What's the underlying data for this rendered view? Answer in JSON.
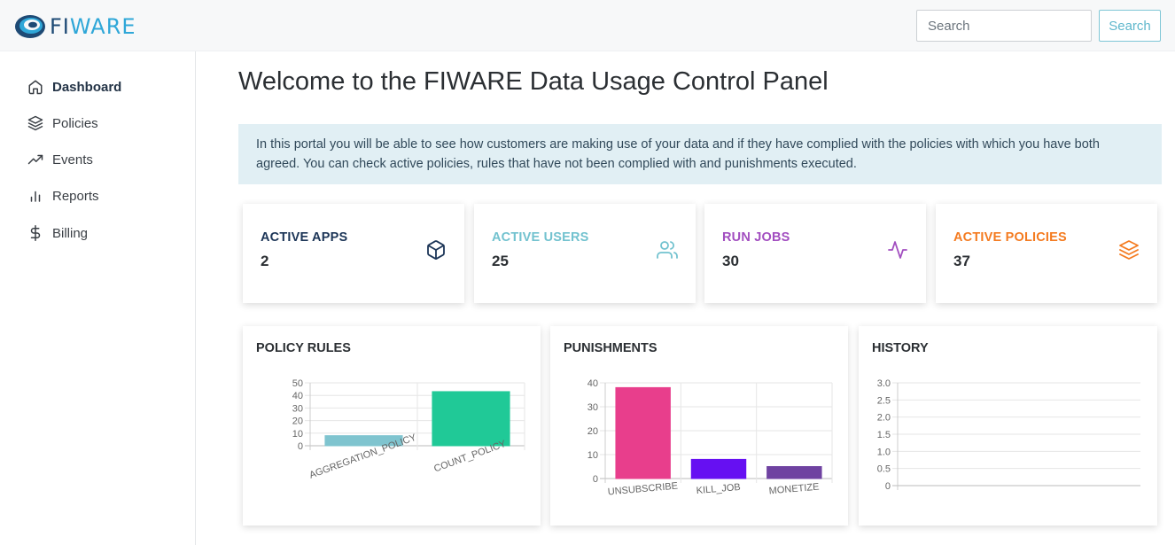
{
  "header": {
    "logo_fi": "FI",
    "logo_ware": "WARE",
    "search_placeholder": "Search",
    "search_button": "Search"
  },
  "sidebar": {
    "items": [
      {
        "label": "Dashboard",
        "icon": "home-icon",
        "active": true
      },
      {
        "label": "Policies",
        "icon": "layers-icon",
        "active": false
      },
      {
        "label": "Events",
        "icon": "trending-up-icon",
        "active": false
      },
      {
        "label": "Reports",
        "icon": "bar-chart-icon",
        "active": false
      },
      {
        "label": "Billing",
        "icon": "dollar-icon",
        "active": false
      }
    ]
  },
  "main": {
    "title": "Welcome to the FIWARE Data Usage Control Panel",
    "info": "In this portal you will be able to see how customers are making use of your data and if they have complied with the policies with which you have both agreed. You can check active policies, rules that have not been complied with and punishments executed."
  },
  "stats": [
    {
      "label": "ACTIVE APPS",
      "value": "2",
      "color": "#1c3557",
      "icon": "box-icon"
    },
    {
      "label": "ACTIVE USERS",
      "value": "25",
      "color": "#72c2cf",
      "icon": "users-icon"
    },
    {
      "label": "RUN JOBS",
      "value": "30",
      "color": "#a24ec0",
      "icon": "activity-icon"
    },
    {
      "label": "ACTIVE POLICIES",
      "value": "37",
      "color": "#f47b20",
      "icon": "layers-icon"
    }
  ],
  "charts": {
    "policy_rules": {
      "title": "POLICY RULES"
    },
    "punishments": {
      "title": "PUNISHMENTS"
    },
    "history": {
      "title": "HISTORY"
    }
  },
  "chart_data": [
    {
      "type": "bar",
      "title": "POLICY RULES",
      "categories": [
        "AGGREGATION_POLICY",
        "COUNT_POLICY"
      ],
      "values": [
        8,
        43
      ],
      "colors": [
        "#7fc4cf",
        "#20c997"
      ],
      "ylim": [
        0,
        50
      ],
      "yticks": [
        0,
        10,
        20,
        30,
        40,
        50
      ]
    },
    {
      "type": "bar",
      "title": "PUNISHMENTS",
      "categories": [
        "UNSUBSCRIBE",
        "KILL_JOB",
        "MONETIZE"
      ],
      "values": [
        38,
        8,
        5
      ],
      "colors": [
        "#e83e8c",
        "#6610f2",
        "#6f42a1"
      ],
      "ylim": [
        0,
        40
      ],
      "yticks": [
        0,
        10,
        20,
        30,
        40
      ]
    },
    {
      "type": "line",
      "title": "HISTORY",
      "categories": [],
      "values": [],
      "ylim": [
        0,
        3.0
      ],
      "yticks": [
        "0",
        "0.5",
        "1.0",
        "1.5",
        "2.0",
        "2.5",
        "3.0"
      ]
    }
  ]
}
